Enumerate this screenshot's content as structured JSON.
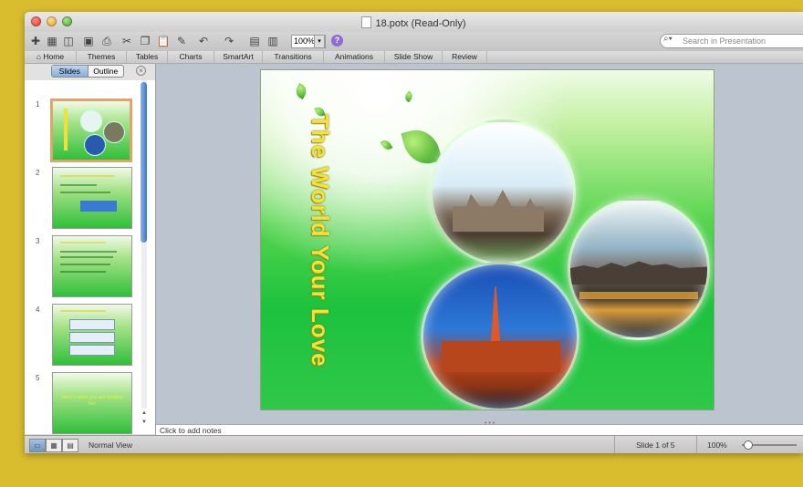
{
  "window": {
    "title": "18.potx (Read-Only)"
  },
  "toolbar": {
    "zoom_value": "100%",
    "search_placeholder": "Search in Presentation",
    "icons": [
      "new-icon",
      "gallery-icon",
      "templates-icon",
      "save-icon",
      "print-icon",
      "cut-icon",
      "copy-icon",
      "paste-icon",
      "format-painter-icon",
      "undo-icon",
      "redo-icon",
      "insert-slide-icon",
      "slide-layout-icon",
      "help-icon"
    ]
  },
  "ribbon": {
    "tabs": [
      "Home",
      "Themes",
      "Tables",
      "Charts",
      "SmartArt",
      "Transitions",
      "Animations",
      "Slide Show",
      "Review"
    ]
  },
  "slides_pane": {
    "tab_slides": "Slides",
    "tab_outline": "Outline",
    "slide_numbers": [
      "1",
      "2",
      "3",
      "4",
      "5"
    ],
    "slide5_text": "Here's what you are looking for!"
  },
  "slide": {
    "title": "The World Your Love"
  },
  "notes": {
    "placeholder": "Click to add notes"
  },
  "status": {
    "view_label": "Normal View",
    "slide_indicator": "Slide 1 of 5",
    "zoom_value": "100%"
  },
  "colors": {
    "slide_green": "#2fc84a",
    "title_yellow": "#f2e23a",
    "selection_border": "#e0a36a"
  }
}
